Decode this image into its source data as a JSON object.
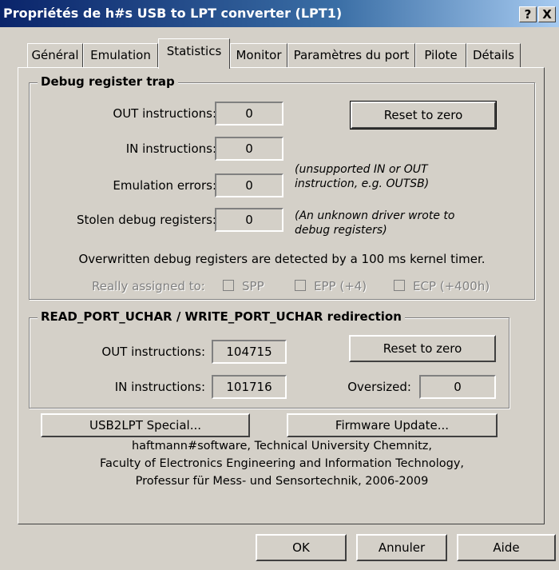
{
  "window": {
    "title": "Propriétés de h#s USB to LPT converter (LPT1)",
    "help_btn": "?",
    "close_btn": "X"
  },
  "tabs": [
    "Général",
    "Emulation",
    "Statistics",
    "Monitor",
    "Paramètres du port",
    "Pilote",
    "Détails"
  ],
  "debug_group": {
    "legend": "Debug register trap",
    "out_label": "OUT instructions:",
    "out_value": "0",
    "in_label": "IN instructions:",
    "in_value": "0",
    "emu_label": "Emulation errors:",
    "emu_value": "0",
    "emu_note_1": "(unsupported IN or OUT",
    "emu_note_2": "instruction, e.g. OUTSB)",
    "stolen_label": "Stolen debug registers:",
    "stolen_value": "0",
    "stolen_note_1": "(An unknown driver wrote to",
    "stolen_note_2": "debug registers)",
    "reset_label": "Reset to zero",
    "info": "Overwritten debug registers are detected by a 100 ms kernel timer.",
    "assigned_label": "Really assigned to:",
    "spp": "SPP",
    "epp": "EPP (+4)",
    "ecp": "ECP (+400h)"
  },
  "redirect_group": {
    "legend": "READ_PORT_UCHAR / WRITE_PORT_UCHAR redirection",
    "out_label": "OUT instructions:",
    "out_value": "104715",
    "in_label": "IN instructions:",
    "in_value": "101716",
    "reset_label": "Reset to zero",
    "oversized_label": "Oversized:",
    "oversized_value": "0"
  },
  "buttons": {
    "special": "USB2LPT Special...",
    "firmware": "Firmware Update...",
    "ok": "OK",
    "cancel": "Annuler",
    "help": "Aide"
  },
  "credits": {
    "line1": "haftmann#software, Technical University Chemnitz,",
    "line2": "Faculty of Electronics Engineering and Information Technology,",
    "line3": "Professur für Mess- und Sensortechnik, 2006-2009"
  }
}
